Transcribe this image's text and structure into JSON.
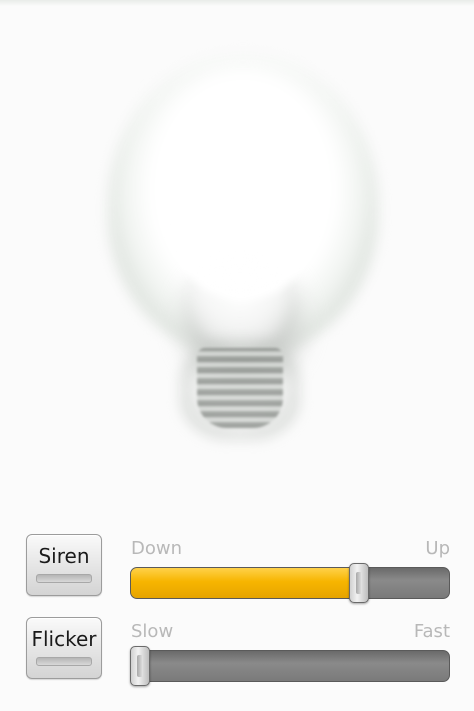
{
  "bulb": {
    "icon": "light-bulb-icon"
  },
  "controls": {
    "siren": {
      "label": "Siren"
    },
    "flicker": {
      "label": "Flicker"
    },
    "pitch_slider": {
      "min_label": "Down",
      "max_label": "Up",
      "value": 0.73
    },
    "speed_slider": {
      "min_label": "Slow",
      "max_label": "Fast",
      "value": 0.0
    }
  },
  "colors": {
    "accent": "#f7b500",
    "background": "#fbfbfb",
    "track": "#7a7a7a"
  }
}
